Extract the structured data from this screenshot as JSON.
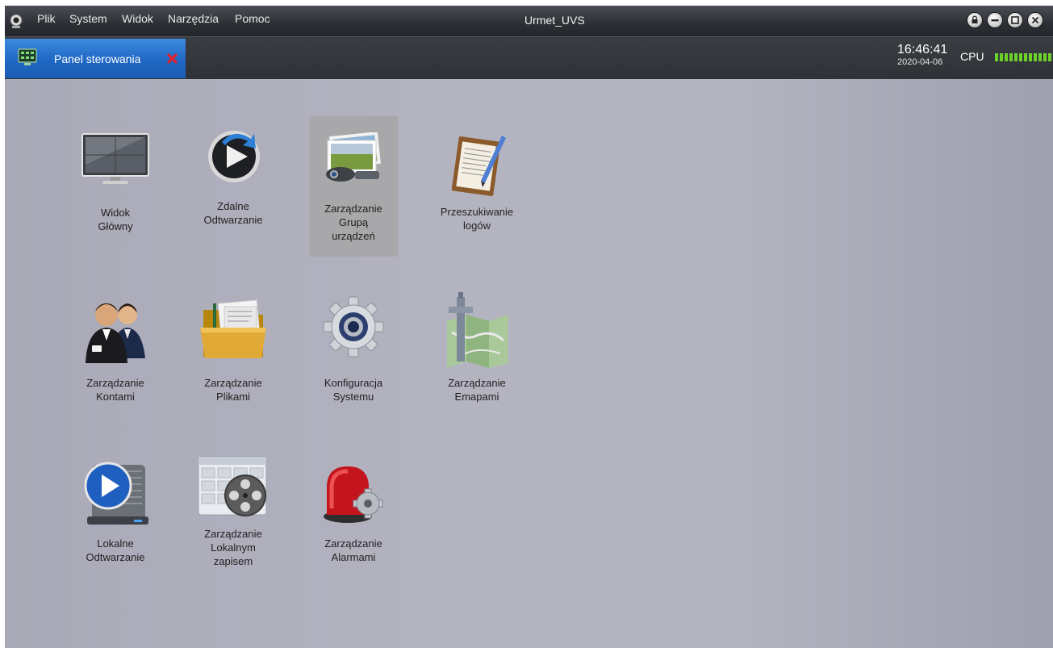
{
  "menubar": {
    "items": [
      "Plik",
      "System",
      "Widok",
      "Narzędzia",
      "Pomoc"
    ],
    "window_title": "Urmet_UVS"
  },
  "tabbar": {
    "tab_label": "Panel sterowania",
    "time": "16:46:41",
    "date": "2020-04-06",
    "cpu_label": "CPU"
  },
  "tiles": [
    {
      "line1": "Widok",
      "line2": "Główny",
      "line3": "",
      "icon": "monitor-icon"
    },
    {
      "line1": "Zdalne",
      "line2": "Odtwarzanie",
      "line3": "",
      "icon": "remote-playback-icon"
    },
    {
      "line1": "Zarządzanie",
      "line2": "Grupą",
      "line3": "urządzeń",
      "icon": "device-group-icon",
      "selected": true
    },
    {
      "line1": "Przeszukiwanie",
      "line2": "logów",
      "line3": "",
      "icon": "log-search-icon"
    },
    {
      "line1": "Zarządzanie",
      "line2": "Kontami",
      "line3": "",
      "icon": "accounts-icon"
    },
    {
      "line1": "Zarządzanie",
      "line2": "Plikami",
      "line3": "",
      "icon": "folder-icon"
    },
    {
      "line1": "Konfiguracja",
      "line2": "Systemu",
      "line3": "",
      "icon": "gear-icon"
    },
    {
      "line1": "Zarządzanie",
      "line2": "Emapami",
      "line3": "",
      "icon": "emap-icon"
    },
    {
      "line1": "Lokalne",
      "line2": "Odtwarzanie",
      "line3": "",
      "icon": "local-playback-icon"
    },
    {
      "line1": "Zarządzanie",
      "line2": "Lokalnym",
      "line3": "zapisem",
      "icon": "local-record-icon"
    },
    {
      "line1": "Zarządzanie",
      "line2": "Alarmami",
      "line3": "",
      "icon": "alarm-icon"
    }
  ],
  "colors": {
    "tab_active": "#1f67c4",
    "cpu_meter": "#6dd12a",
    "close_mark": "#e0232b"
  }
}
